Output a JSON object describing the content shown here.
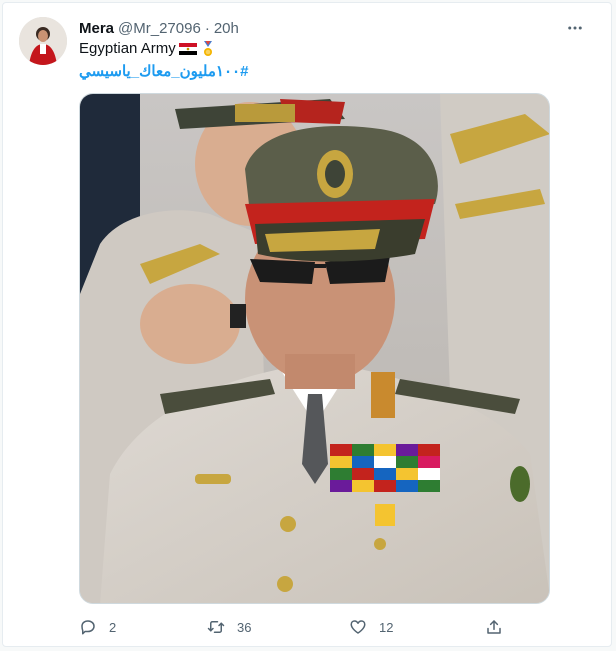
{
  "tweet": {
    "author_name": "Mera",
    "handle": "@Mr_27096",
    "separator": "·",
    "time": "20h",
    "text": "Egyptian Army",
    "hashtag": "#١٠٠مليون_معاك_ياسيسي",
    "media_alt": "Photo of a man in a military uniform with a peaked cap and sunglasses",
    "icons": {
      "more": "more-horizontal-icon",
      "reply": "reply-icon",
      "retweet": "retweet-icon",
      "like": "heart-icon",
      "share": "share-icon",
      "flag": "egypt-flag-icon",
      "medal": "medal-icon"
    }
  },
  "actions": {
    "replies": "2",
    "retweets": "36",
    "likes": "12"
  },
  "colors": {
    "accent": "#1d9bf0",
    "secondary_text": "#536471",
    "border": "#e6ecf0"
  }
}
